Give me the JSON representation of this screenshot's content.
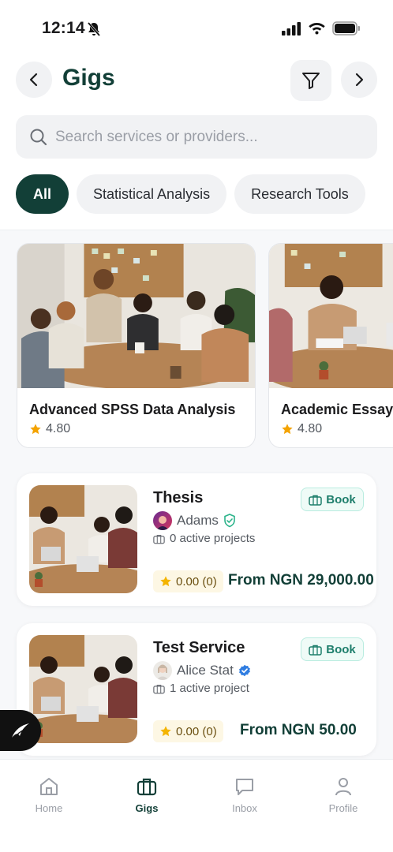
{
  "status_bar": {
    "time": "12:14"
  },
  "header": {
    "title": "Gigs"
  },
  "search": {
    "placeholder": "Search services or providers..."
  },
  "categories": [
    {
      "label": "All",
      "active": true
    },
    {
      "label": "Statistical Analysis",
      "active": false
    },
    {
      "label": "Research Tools",
      "active": false
    }
  ],
  "featured": [
    {
      "title": "Advanced SPSS Data Analysis",
      "rating": "4.80"
    },
    {
      "title": "Academic Essay",
      "rating": "4.80"
    }
  ],
  "gigs": [
    {
      "title": "Thesis",
      "provider": "Adams",
      "provider_badge": "shield-check-icon",
      "projects": "0 active projects",
      "book_label": "Book",
      "rating": "0.00 (0)",
      "price": "From NGN 29,000.00"
    },
    {
      "title": "Test Service",
      "provider": "Alice Stat",
      "provider_badge": "verified-icon",
      "projects": "1 active project",
      "book_label": "Book",
      "rating": "0.00 (0)",
      "price": "From NGN 50.00"
    }
  ],
  "tabbar": {
    "home": "Home",
    "gigs": "Gigs",
    "inbox": "Inbox",
    "profile": "Profile"
  },
  "colors": {
    "brand": "#123f37",
    "accent_book": "#1f7f6c",
    "star": "#f4b400",
    "verified": "#2f7de1"
  }
}
